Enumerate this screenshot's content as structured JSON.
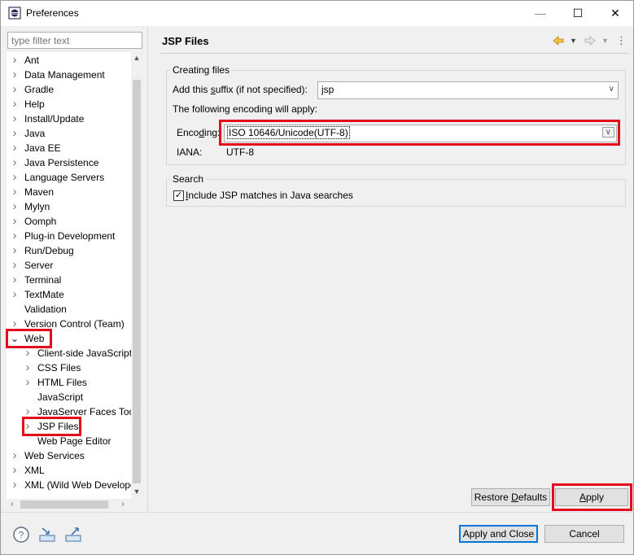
{
  "window": {
    "title": "Preferences",
    "minimize_glyph": "—",
    "maximize_glyph": "☐",
    "close_glyph": "✕"
  },
  "filter": {
    "placeholder": "type filter text"
  },
  "tree": {
    "items": [
      {
        "label": "Ant",
        "expander": ">"
      },
      {
        "label": "Data Management",
        "expander": ">"
      },
      {
        "label": "Gradle",
        "expander": ">"
      },
      {
        "label": "Help",
        "expander": ">"
      },
      {
        "label": "Install/Update",
        "expander": ">"
      },
      {
        "label": "Java",
        "expander": ">"
      },
      {
        "label": "Java EE",
        "expander": ">"
      },
      {
        "label": "Java Persistence",
        "expander": ">"
      },
      {
        "label": "Language Servers",
        "expander": ">"
      },
      {
        "label": "Maven",
        "expander": ">"
      },
      {
        "label": "Mylyn",
        "expander": ">"
      },
      {
        "label": "Oomph",
        "expander": ">"
      },
      {
        "label": "Plug-in Development",
        "expander": ">"
      },
      {
        "label": "Run/Debug",
        "expander": ">"
      },
      {
        "label": "Server",
        "expander": ">"
      },
      {
        "label": "Terminal",
        "expander": ">"
      },
      {
        "label": "TextMate",
        "expander": ">"
      },
      {
        "label": "Validation",
        "expander": ""
      },
      {
        "label": "Version Control (Team)",
        "expander": ">"
      },
      {
        "label": "Web",
        "expander": "v"
      },
      {
        "label": "Client-side JavaScript",
        "expander": ">"
      },
      {
        "label": "CSS Files",
        "expander": ">"
      },
      {
        "label": "HTML Files",
        "expander": ">"
      },
      {
        "label": "JavaScript",
        "expander": ""
      },
      {
        "label": "JavaServer Faces Tools",
        "expander": ">"
      },
      {
        "label": "JSP Files",
        "expander": ">"
      },
      {
        "label": "Web Page Editor",
        "expander": ""
      },
      {
        "label": "Web Services",
        "expander": ">"
      },
      {
        "label": "XML",
        "expander": ">"
      },
      {
        "label": "XML (Wild Web Developer)",
        "expander": ">"
      }
    ]
  },
  "page": {
    "title": "JSP Files",
    "creating_files": {
      "group_label": "Creating files",
      "suffix_label_pre": "Add this ",
      "suffix_label_u": "s",
      "suffix_label_post": "uffix (if not specified):",
      "suffix_value": "jsp",
      "encoding_note": "The following encoding will apply:",
      "encoding_label_pre": "Enco",
      "encoding_label_u": "d",
      "encoding_label_post": "ing:",
      "encoding_value": "ISO 10646/Unicode(UTF-8)",
      "iana_label": "IANA:",
      "iana_value": "UTF-8"
    },
    "search": {
      "group_label": "Search",
      "include_label_pre": "",
      "include_label_u": "I",
      "include_label_post": "nclude JSP matches in Java searches",
      "include_checked": true
    }
  },
  "buttons": {
    "restore_defaults_pre": "Restore ",
    "restore_defaults_u": "D",
    "restore_defaults_post": "efaults",
    "apply_u": "A",
    "apply_post": "pply",
    "apply_and_close": "Apply and Close",
    "cancel": "Cancel"
  },
  "colors": {
    "highlight": "#e30b1c",
    "default_button_border": "#0078d7",
    "nav_back_arrow": "#e0a020"
  },
  "icons": {
    "help": "help-icon",
    "import": "import-icon",
    "export": "export-icon",
    "back": "back-arrow-icon",
    "forward": "forward-arrow-icon",
    "menu": "view-menu-icon"
  }
}
